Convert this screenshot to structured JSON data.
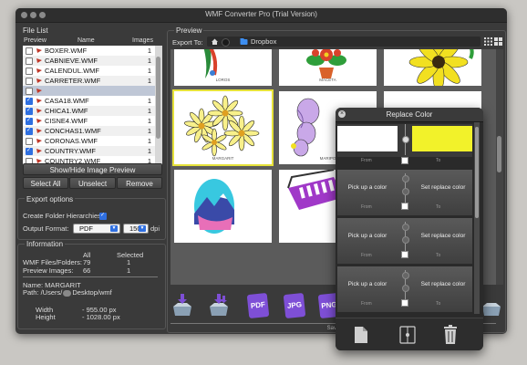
{
  "window": {
    "title": "WMF Converter Pro (Trial Version)"
  },
  "file_list": {
    "section_label": "File List",
    "columns": {
      "preview": "Preview",
      "name": "Name",
      "images": "Images"
    },
    "rows": [
      {
        "name": "BOXER.WMF",
        "images": "1",
        "checked": false
      },
      {
        "name": "CABNIEVE.WMF",
        "images": "1",
        "checked": false
      },
      {
        "name": "CALENDUL.WMF",
        "images": "1",
        "checked": false
      },
      {
        "name": "CARRETER.WMF",
        "images": "1",
        "checked": false
      },
      {
        "name": "",
        "images": "",
        "checked": false
      },
      {
        "name": "CASA18.WMF",
        "images": "1",
        "checked": true
      },
      {
        "name": "CHICA1.WMF",
        "images": "1",
        "checked": true
      },
      {
        "name": "CISNE4.WMF",
        "images": "1",
        "checked": true
      },
      {
        "name": "CONCHAS1.WMF",
        "images": "1",
        "checked": true
      },
      {
        "name": "CORONAS.WMF",
        "images": "1",
        "checked": false
      },
      {
        "name": "COUNTRY.WMF",
        "images": "1",
        "checked": true
      },
      {
        "name": "COUNTRY2.WMF",
        "images": "1",
        "checked": false
      }
    ],
    "show_hide_label": "Show/Hide Image Preview",
    "select_all_label": "Select All",
    "unselect_label": "Unselect",
    "remove_label": "Remove"
  },
  "export_options": {
    "section_label": "Export options",
    "create_folder_label": "Create Folder Hierarchies:",
    "create_folder_checked": true,
    "output_format_label": "Output Format:",
    "format_value": "PDF",
    "dpi_value": "150",
    "dpi_label": "dpi"
  },
  "information": {
    "section_label": "Information",
    "col_all": "All",
    "col_selected": "Selected",
    "wmf_label": "WMF Files/Folders:",
    "wmf_all": "79",
    "wmf_selected": "1",
    "preview_label": "Preview Images:",
    "preview_all": "66",
    "preview_selected": "1",
    "name_line": "Name: MARGARIT",
    "path_prefix": "Path: /Users/",
    "path_suffix": "Desktop/wmf",
    "width_label": "Width",
    "width_value": "- 955.00 px",
    "height_label": "Height",
    "height_value": "- 1028.00 px"
  },
  "preview": {
    "section_label": "Preview",
    "export_to_label": "Export To:",
    "export_dest": "Dropbox",
    "captions": [
      "LOROS",
      "MACETA",
      "",
      "MARGARIT",
      "MARIPO",
      "",
      "",
      "",
      ""
    ]
  },
  "toolbar": {
    "pdf_label": "PDF",
    "jpg_label": "JPG",
    "png_label": "PNG",
    "save_label": "Save"
  },
  "replace_color": {
    "title": "Replace Color",
    "from_label": "From",
    "to_label": "To",
    "rows": [
      {
        "pick_label": "Pick up a color",
        "set_label": "Set replace color"
      },
      {
        "pick_label": "Pick up a color",
        "set_label": "Set replace color"
      },
      {
        "pick_label": "Pick up a color",
        "set_label": "Set replace color"
      }
    ],
    "first_from_color": "#ffffff",
    "first_to_color": "#f2f22a"
  },
  "colors": {
    "accent": "#2f6fe0",
    "highlight": "#e6e23a",
    "toolbar_purple": "#7e4fd6"
  }
}
